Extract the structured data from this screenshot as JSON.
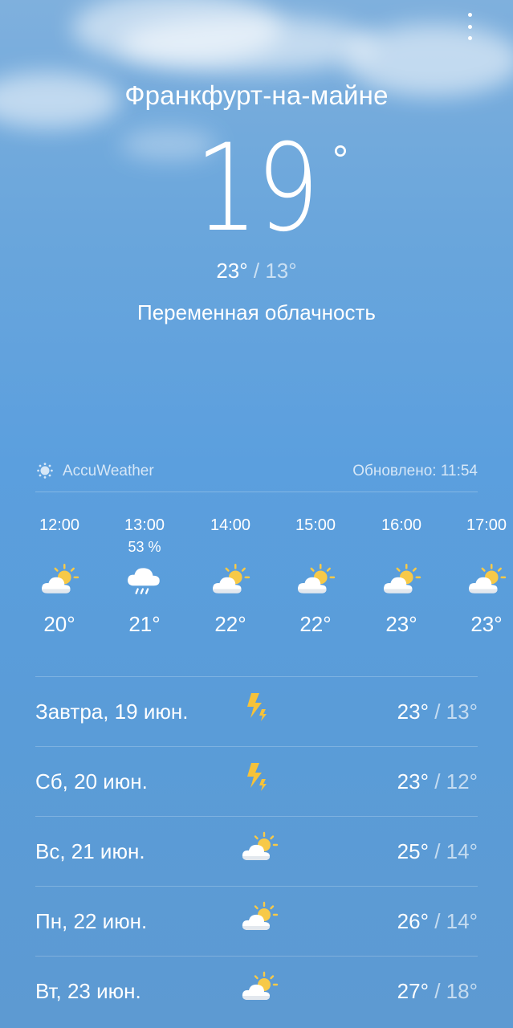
{
  "city": "Франкфурт-на-майне",
  "current": {
    "temperature": "19",
    "degree_symbol": "°",
    "high": "23°",
    "separator": " / ",
    "low": "13°",
    "condition": "Переменная облачность"
  },
  "provider": {
    "name": "AccuWeather",
    "updated": "Обновлено: 11:54"
  },
  "hourly": [
    {
      "time": "12:00",
      "precip": "",
      "icon": "partly-cloudy-icon",
      "temp": "20°"
    },
    {
      "time": "13:00",
      "precip": "53 %",
      "icon": "rain-icon",
      "temp": "21°"
    },
    {
      "time": "14:00",
      "precip": "",
      "icon": "partly-cloudy-icon",
      "temp": "22°"
    },
    {
      "time": "15:00",
      "precip": "",
      "icon": "partly-cloudy-icon",
      "temp": "22°"
    },
    {
      "time": "16:00",
      "precip": "",
      "icon": "partly-cloudy-icon",
      "temp": "23°"
    },
    {
      "time": "17:00",
      "precip": "",
      "icon": "partly-cloudy-icon",
      "temp": "23°"
    }
  ],
  "daily": [
    {
      "label": "Завтра, 19 июн.",
      "icon": "thunder-icon",
      "high": "23°",
      "sep": " / ",
      "low": "13°"
    },
    {
      "label": "Сб, 20 июн.",
      "icon": "thunder-icon",
      "high": "23°",
      "sep": " / ",
      "low": "12°"
    },
    {
      "label": "Вс, 21 июн.",
      "icon": "partly-cloudy-icon",
      "high": "25°",
      "sep": " / ",
      "low": "14°"
    },
    {
      "label": "Пн, 22 июн.",
      "icon": "partly-cloudy-icon",
      "high": "26°",
      "sep": " / ",
      "low": "14°"
    },
    {
      "label": "Вт, 23 июн.",
      "icon": "partly-cloudy-icon",
      "high": "27°",
      "sep": " / ",
      "low": "18°"
    }
  ],
  "colors": {
    "sky_top": "#7fb0dd",
    "sky_bottom": "#5d9ad2",
    "sun": "#f7c948",
    "thunder": "#f5c23a"
  }
}
